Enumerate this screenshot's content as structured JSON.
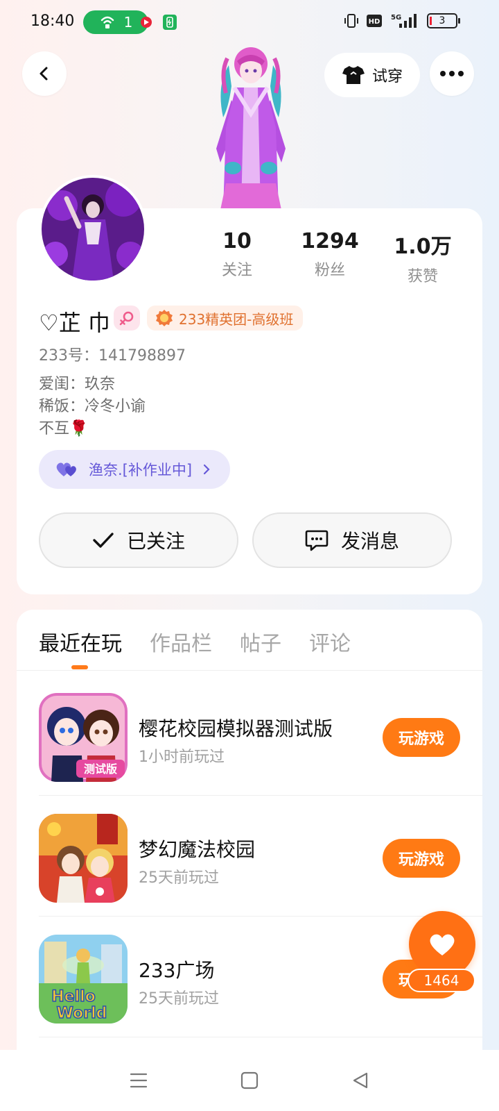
{
  "status_bar": {
    "time": "18:40",
    "hotspot_count": "1",
    "network": "5G",
    "hd": "HD",
    "battery": "3"
  },
  "header": {
    "try_on_label": "试穿"
  },
  "stats": [
    {
      "num": "10",
      "label": "关注"
    },
    {
      "num": "1294",
      "label": "粉丝"
    },
    {
      "num": "1.0万",
      "label": "获赞"
    }
  ],
  "profile": {
    "username": "♡芷 巾",
    "group_badge": "233精英团-高级班",
    "id_label": "233号：",
    "id_value": "141798897",
    "bio": [
      "爱闺：玖奈",
      "稀饭：冷冬小谕",
      "不互🌹"
    ],
    "cp_label": "渔奈.[补作业中]"
  },
  "actions": {
    "follow_label": "已关注",
    "message_label": "发消息"
  },
  "tabs": [
    "最近在玩",
    "作品栏",
    "帖子",
    "评论"
  ],
  "games": [
    {
      "title": "樱花校园模拟器测试版",
      "sub": "1小时前玩过",
      "play": "玩游戏",
      "badge": "测试版"
    },
    {
      "title": "梦幻魔法校园",
      "sub": "25天前玩过",
      "play": "玩游戏"
    },
    {
      "title": "233广场",
      "sub": "25天前玩过",
      "play": "玩游戏",
      "badge1": "Hello",
      "badge2": "World"
    }
  ],
  "like_count": "1464",
  "colors": {
    "accent": "#ff7a14",
    "cp_purple": "#6558d8",
    "hotspot_green": "#21b35a"
  }
}
